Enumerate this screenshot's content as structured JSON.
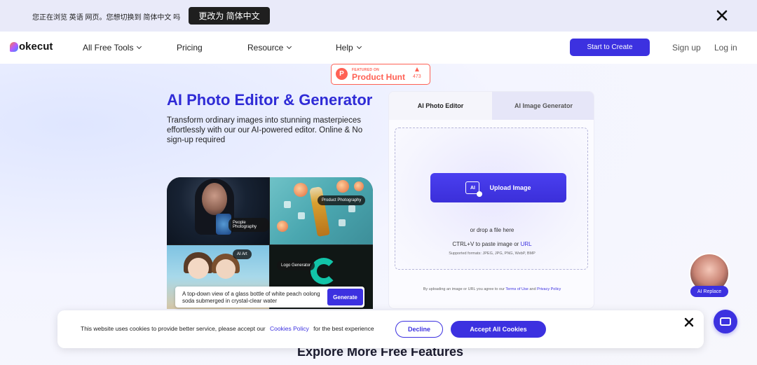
{
  "banner": {
    "text": "您正在浏览 英语 网页。您想切换到 简体中文 吗",
    "switch_label": "更改为 简体中文"
  },
  "nav": {
    "logo_text": "okecut",
    "items": [
      {
        "label": "All Free Tools",
        "dropdown": true
      },
      {
        "label": "Pricing",
        "dropdown": false
      },
      {
        "label": "Resource",
        "dropdown": true
      },
      {
        "label": "Help",
        "dropdown": true
      }
    ],
    "start_label": "Start to Create",
    "signup_label": "Sign up",
    "login_label": "Log in"
  },
  "product_hunt": {
    "featured": "FEATURED ON",
    "name": "Product Hunt",
    "count": "473",
    "letter": "P"
  },
  "hero": {
    "title": "AI Photo Editor & Generator",
    "description": "Transform ordinary images into stunning masterpieces effortlessly with our our AI-powered editor. Online & No sign-up required"
  },
  "collage": {
    "labels": [
      "People Photography",
      "Product Photography",
      "AI Art",
      "Logo Generator"
    ],
    "prompt": "A top-down view of a glass bottle of white peach oolong soda submerged in crystal-clear water",
    "generate_label": "Generate"
  },
  "editor": {
    "tabs": [
      "AI Photo Editor",
      "AI Image Generator"
    ],
    "active_tab": "AI Photo Editor",
    "upload_label": "Upload Image",
    "upload_icon_text": "AI",
    "drop_text": "or drop a file here",
    "paste_text": "CTRL+V to paste image or",
    "url_label": "URL",
    "formats": "Supported formats: JPEG, JPG, PNG, WebP, BMP",
    "terms_prefix": "By uploading an image or URL you agree to our",
    "terms_label": "Terms of Use",
    "terms_and": "and",
    "privacy_label": "Privacy Policy"
  },
  "ai_replace": {
    "label": "AI Replace"
  },
  "cookie": {
    "text_before": "This website uses cookies to provide better service, please accept our",
    "policy_label": "Cookies Policy",
    "text_after": "for the best experience",
    "decline_label": "Decline",
    "accept_label": "Accept All Cookies"
  },
  "explore_title": "Explore More Free Features",
  "colors": {
    "accent": "#3c31e0",
    "title": "#2f2bd6",
    "product_hunt": "#ff6154"
  }
}
